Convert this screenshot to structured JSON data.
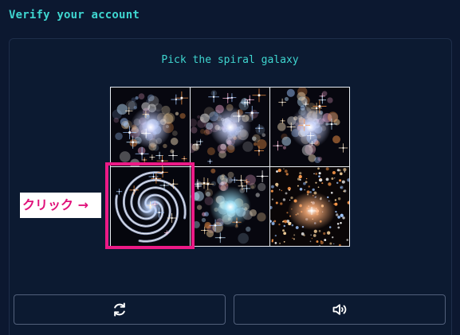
{
  "header": {
    "title": "Verify your account"
  },
  "captcha": {
    "instruction": "Pick the spiral galaxy",
    "tiles": [
      {
        "kind": "irregular-galaxy",
        "selected": false
      },
      {
        "kind": "irregular-galaxy",
        "selected": false
      },
      {
        "kind": "irregular-galaxy",
        "selected": false
      },
      {
        "kind": "spiral-galaxy",
        "selected": true
      },
      {
        "kind": "irregular-galaxy",
        "selected": false
      },
      {
        "kind": "elliptical-galaxy",
        "selected": false
      }
    ],
    "annotation_label": "クリック →",
    "highlight_color": "#ec1a86"
  },
  "controls": {
    "refresh_icon": "refresh-icon",
    "audio_icon": "speaker-icon"
  },
  "colors": {
    "background": "#0c1830",
    "accent": "#3fd6d0",
    "button_border": "#52607b"
  }
}
